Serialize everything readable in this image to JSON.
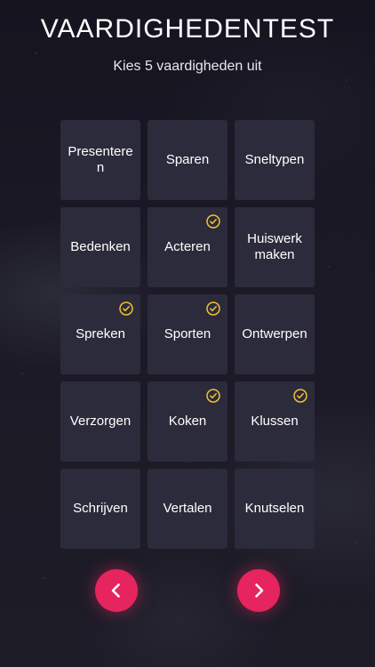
{
  "header": {
    "title": "VAARDIGHEDENTEST",
    "subtitle": "Kies 5 vaardigheden uit"
  },
  "skills": [
    {
      "label": "Presenteren",
      "selected": false
    },
    {
      "label": "Sparen",
      "selected": false
    },
    {
      "label": "Sneltypen",
      "selected": false
    },
    {
      "label": "Bedenken",
      "selected": false
    },
    {
      "label": "Acteren",
      "selected": true
    },
    {
      "label": "Huiswerk maken",
      "selected": false
    },
    {
      "label": "Spreken",
      "selected": true
    },
    {
      "label": "Sporten",
      "selected": true
    },
    {
      "label": "Ontwerpen",
      "selected": false
    },
    {
      "label": "Verzorgen",
      "selected": false
    },
    {
      "label": "Koken",
      "selected": true
    },
    {
      "label": "Klussen",
      "selected": true
    },
    {
      "label": "Schrijven",
      "selected": false
    },
    {
      "label": "Vertalen",
      "selected": false
    },
    {
      "label": "Knutselen",
      "selected": false
    }
  ],
  "navigation": {
    "prev_icon": "chevron-left-icon",
    "next_icon": "chevron-right-icon"
  },
  "colors": {
    "accent": "#e6245e",
    "check": "#f2c230",
    "tile": "#2c2b3b"
  }
}
